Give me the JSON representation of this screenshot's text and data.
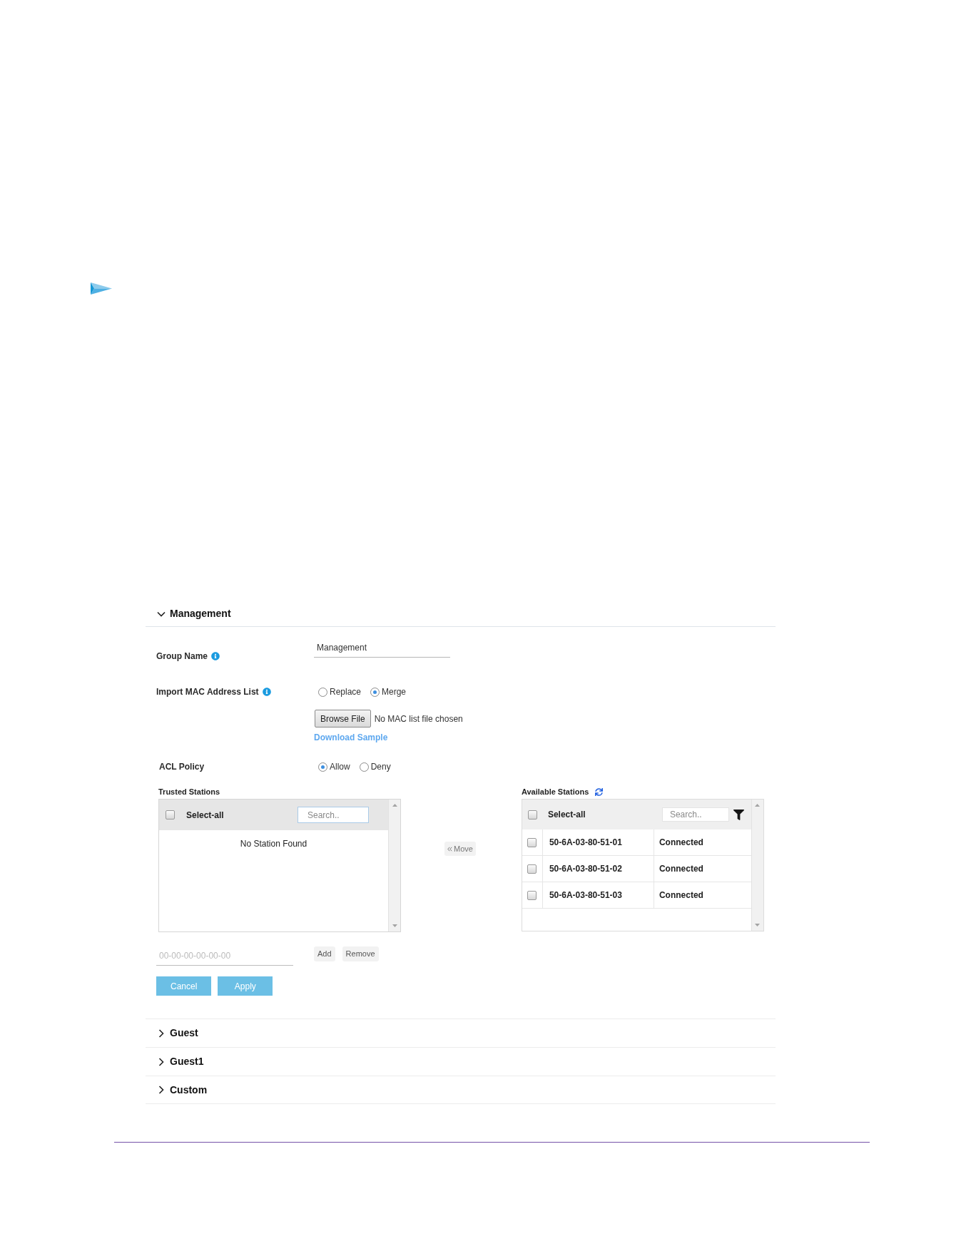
{
  "sections": [
    {
      "title": "Management",
      "expanded": true,
      "content": {
        "group_name": {
          "label": "Group Name",
          "info": true,
          "value": "Management"
        },
        "import_mac": {
          "label": "Import MAC Address List",
          "info": true,
          "options": [
            {
              "label": "Replace",
              "selected": false
            },
            {
              "label": "Merge",
              "selected": true
            }
          ],
          "browse_button": "Browse File",
          "file_status": "No MAC list file chosen",
          "download_link": "Download Sample"
        },
        "acl_policy": {
          "label": "ACL Policy",
          "info": false,
          "options": [
            {
              "label": "Allow",
              "selected": true
            },
            {
              "label": "Deny",
              "selected": false
            }
          ]
        },
        "trusted_stations": {
          "title": "Trusted Stations",
          "select_all": {
            "label": "Select-all",
            "checked": false
          },
          "search": {
            "placeholder": "Search.."
          },
          "empty_message": "No Station Found"
        },
        "move_button": "Move",
        "available_stations": {
          "title": "Available Stations",
          "select_all": {
            "label": "Select-all",
            "checked": false
          },
          "search": {
            "placeholder": "Search.."
          },
          "rows": [
            {
              "checked": false,
              "mac": "50-6A-03-80-51-01",
              "status": "Connected"
            },
            {
              "checked": false,
              "mac": "50-6A-03-80-51-02",
              "status": "Connected"
            },
            {
              "checked": false,
              "mac": "50-6A-03-80-51-03",
              "status": "Connected"
            }
          ]
        },
        "mac_entry": {
          "placeholder": "00-00-00-00-00-00"
        },
        "entry_buttons": [
          "Add",
          "Remove"
        ],
        "action_buttons": [
          "Cancel",
          "Apply"
        ]
      }
    },
    {
      "title": "Guest",
      "expanded": false
    },
    {
      "title": "Guest1",
      "expanded": false
    },
    {
      "title": "Custom",
      "expanded": false
    }
  ]
}
